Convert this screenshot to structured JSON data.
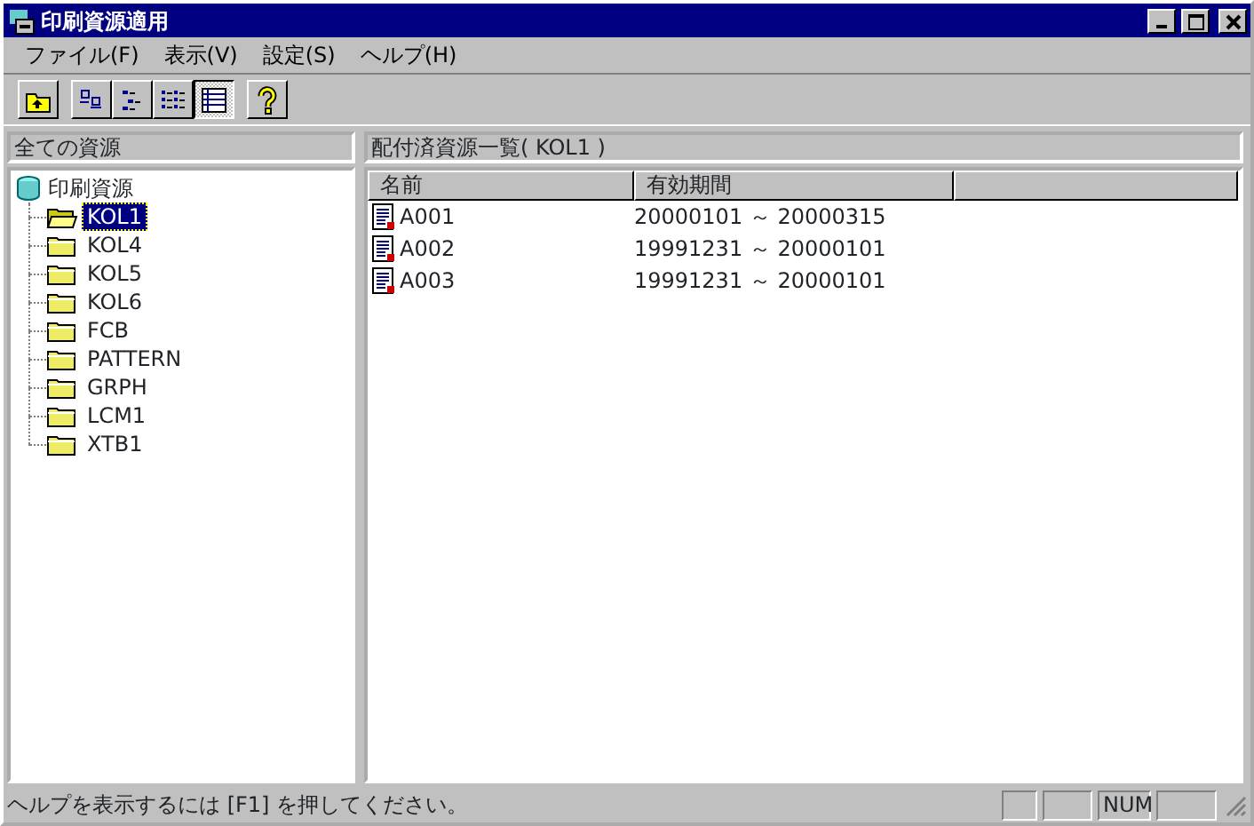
{
  "window": {
    "title": "印刷資源適用"
  },
  "menu": [
    "ファイル(F)",
    "表示(V)",
    "設定(S)",
    "ヘルプ(H)"
  ],
  "toolbar": [
    {
      "kind": "up",
      "selected": false
    },
    {
      "kind": "large",
      "selected": false
    },
    {
      "kind": "small",
      "selected": false
    },
    {
      "kind": "list",
      "selected": false
    },
    {
      "kind": "details",
      "selected": true
    },
    {
      "kind": "help",
      "selected": false
    }
  ],
  "tree": {
    "title": "全ての資源",
    "root": {
      "label": "印刷資源",
      "expanded": true,
      "children": [
        {
          "label": "KOL1",
          "selected": true
        },
        {
          "label": "KOL4",
          "selected": false
        },
        {
          "label": "KOL5",
          "selected": false
        },
        {
          "label": "KOL6",
          "selected": false
        },
        {
          "label": "FCB",
          "selected": false
        },
        {
          "label": "PATTERN",
          "selected": false
        },
        {
          "label": "GRPH",
          "selected": false
        },
        {
          "label": "LCM1",
          "selected": false
        },
        {
          "label": "XTB1",
          "selected": false
        }
      ]
    }
  },
  "list": {
    "title": "配付済資源一覧( KOL1 )",
    "columns": [
      "名前",
      "有効期間"
    ],
    "rows": [
      [
        "A001",
        "20000101 ～ 20000315"
      ],
      [
        "A002",
        "19991231 ～ 20000101"
      ],
      [
        "A003",
        "19991231 ～ 20000101"
      ]
    ]
  },
  "status_bar": {
    "message": "ヘルプを表示するには [F1] を押してください。",
    "indicators": [
      "NUM"
    ]
  }
}
